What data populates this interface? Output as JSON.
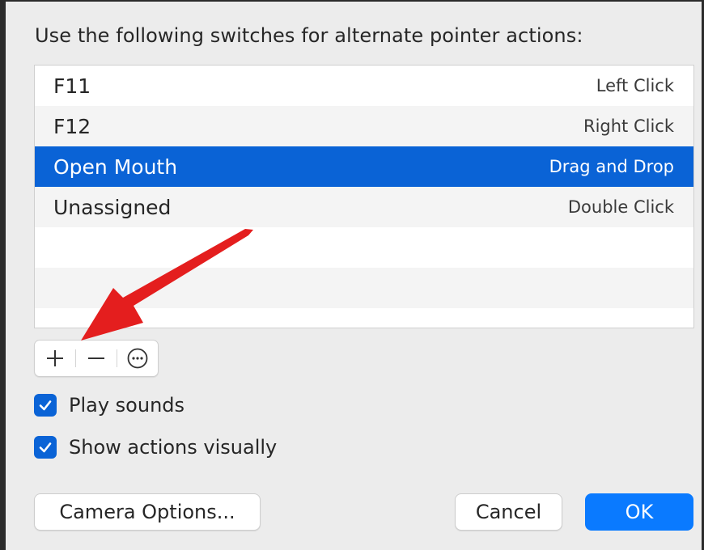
{
  "heading": "Use the following switches for alternate pointer actions:",
  "switch_table": {
    "rows": [
      {
        "switch": "F11",
        "action": "Left Click",
        "selected": false
      },
      {
        "switch": "F12",
        "action": "Right Click",
        "selected": false
      },
      {
        "switch": "Open Mouth",
        "action": "Drag and Drop",
        "selected": true
      },
      {
        "switch": "Unassigned",
        "action": "Double Click",
        "selected": false
      }
    ]
  },
  "toolbar": {
    "add_label": "+",
    "remove_label": "−"
  },
  "options": {
    "play_sounds": {
      "label": "Play sounds",
      "checked": true
    },
    "show_actions": {
      "label": "Show actions visually",
      "checked": true
    }
  },
  "buttons": {
    "camera_options": "Camera Options...",
    "cancel": "Cancel",
    "ok": "OK"
  },
  "colors": {
    "selection": "#0a63d6",
    "primary_button": "#0a7aff",
    "annotation_arrow": "#e41e1e"
  },
  "icons": {
    "add": "plus-icon",
    "remove": "minus-icon",
    "more": "ellipsis-circle-icon",
    "checkbox": "checkmark-icon",
    "annotation": "red-arrow-annotation"
  }
}
